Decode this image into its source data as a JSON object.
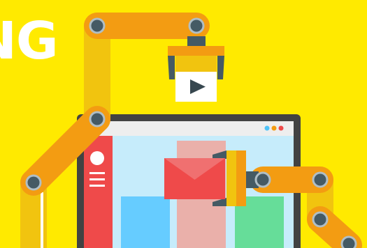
{
  "headline": {
    "text": "NG"
  },
  "colors": {
    "background": "#ffea00",
    "arm_orange": "#f39c12",
    "arm_yellow": "#f1c40f",
    "joint_dark": "#455a64",
    "monitor_frame": "#424242",
    "screen_bg": "#c6ecfb",
    "sidebar_red": "#ef4a4a",
    "envelope_red": "#ef4a4a",
    "bar_blue": "#66ccff",
    "bar_pink": "#eab0aa",
    "bar_green": "#66dd99",
    "window_dots": [
      "#4fc3f7",
      "#f39c12",
      "#ef4a4a"
    ]
  },
  "icons": {
    "play": "play-icon",
    "envelope": "envelope-icon",
    "menu": "hamburger-menu-icon",
    "avatar": "avatar-circle-icon"
  }
}
